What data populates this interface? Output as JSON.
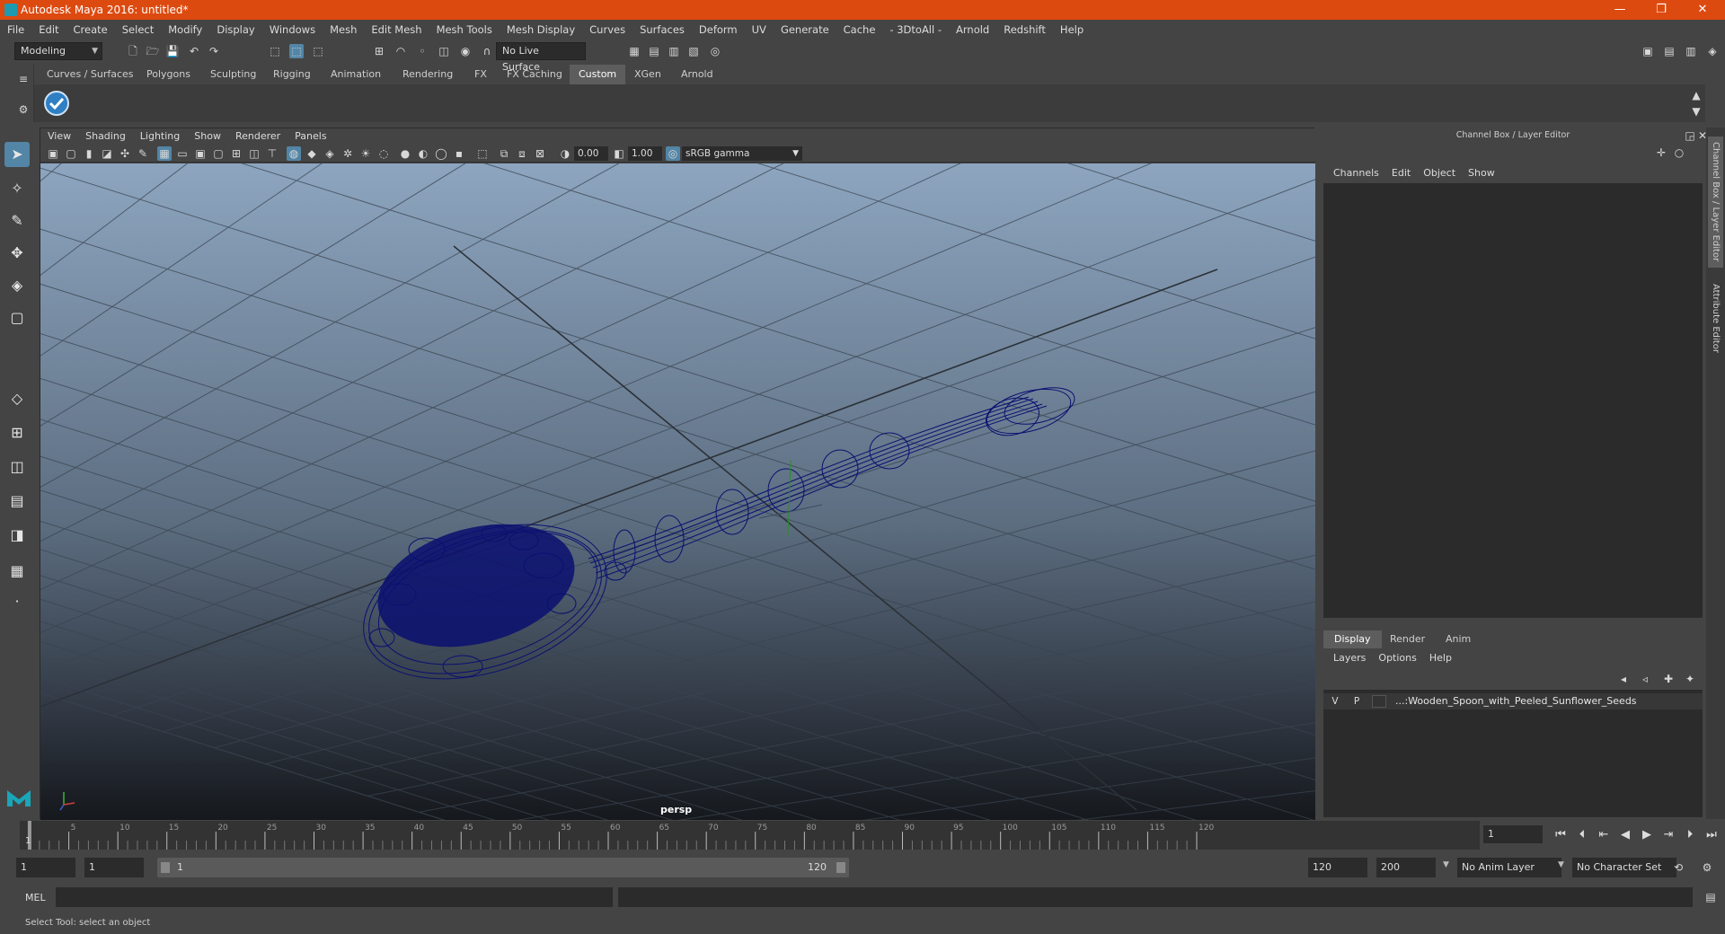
{
  "window": {
    "title": "Autodesk Maya 2016: untitled*",
    "minimize": "—",
    "maximize": "❐",
    "close": "✕"
  },
  "menubar": [
    "File",
    "Edit",
    "Create",
    "Select",
    "Modify",
    "Display",
    "Windows",
    "Mesh",
    "Edit Mesh",
    "Mesh Tools",
    "Mesh Display",
    "Curves",
    "Surfaces",
    "Deform",
    "UV",
    "Generate",
    "Cache",
    "- 3DtoAll -",
    "Arnold",
    "Redshift",
    "Help"
  ],
  "statusline": {
    "mode": "Modeling",
    "live_surface": "No Live Surface"
  },
  "shelf": {
    "tabs": [
      "Curves / Surfaces",
      "Polygons",
      "Sculpting",
      "Rigging",
      "Animation",
      "Rendering",
      "FX",
      "FX Caching",
      "Custom",
      "XGen",
      "Arnold"
    ],
    "active_tab": "Custom"
  },
  "viewport": {
    "menu": [
      "View",
      "Shading",
      "Lighting",
      "Show",
      "Renderer",
      "Panels"
    ],
    "exposure": "0.00",
    "gamma": "1.00",
    "color_space": "sRGB gamma",
    "camera": "persp"
  },
  "channel_box": {
    "title": "Channel Box / Layer Editor",
    "menu": [
      "Channels",
      "Edit",
      "Object",
      "Show"
    ]
  },
  "layer_editor": {
    "tabs": [
      "Display",
      "Render",
      "Anim"
    ],
    "active_tab": "Display",
    "menu": [
      "Layers",
      "Options",
      "Help"
    ],
    "layers": [
      {
        "v": "V",
        "p": "P",
        "name": "...:Wooden_Spoon_with_Peeled_Sunflower_Seeds"
      }
    ]
  },
  "side_tabs": [
    "Channel Box / Layer Editor",
    "Attribute Editor"
  ],
  "timeline": {
    "ticks": [
      "5",
      "10",
      "15",
      "20",
      "25",
      "30",
      "35",
      "40",
      "45",
      "50",
      "55",
      "60",
      "65",
      "70",
      "75",
      "80",
      "85",
      "90",
      "95",
      "100",
      "105",
      "110",
      "115",
      "120"
    ],
    "start_label": "1",
    "current_frame": "1"
  },
  "range": {
    "start": "1",
    "playback_start": "1",
    "bar_start": "1",
    "bar_end": "120",
    "playback_end": "120",
    "end": "200",
    "anim_layer": "No Anim Layer",
    "character_set": "No Character Set"
  },
  "command": {
    "label": "MEL"
  },
  "help_line": "Select Tool: select an object",
  "colors": {
    "title_bar": "#dd4a10",
    "selection": "#5285a6",
    "wireframe": "#0a1070"
  }
}
